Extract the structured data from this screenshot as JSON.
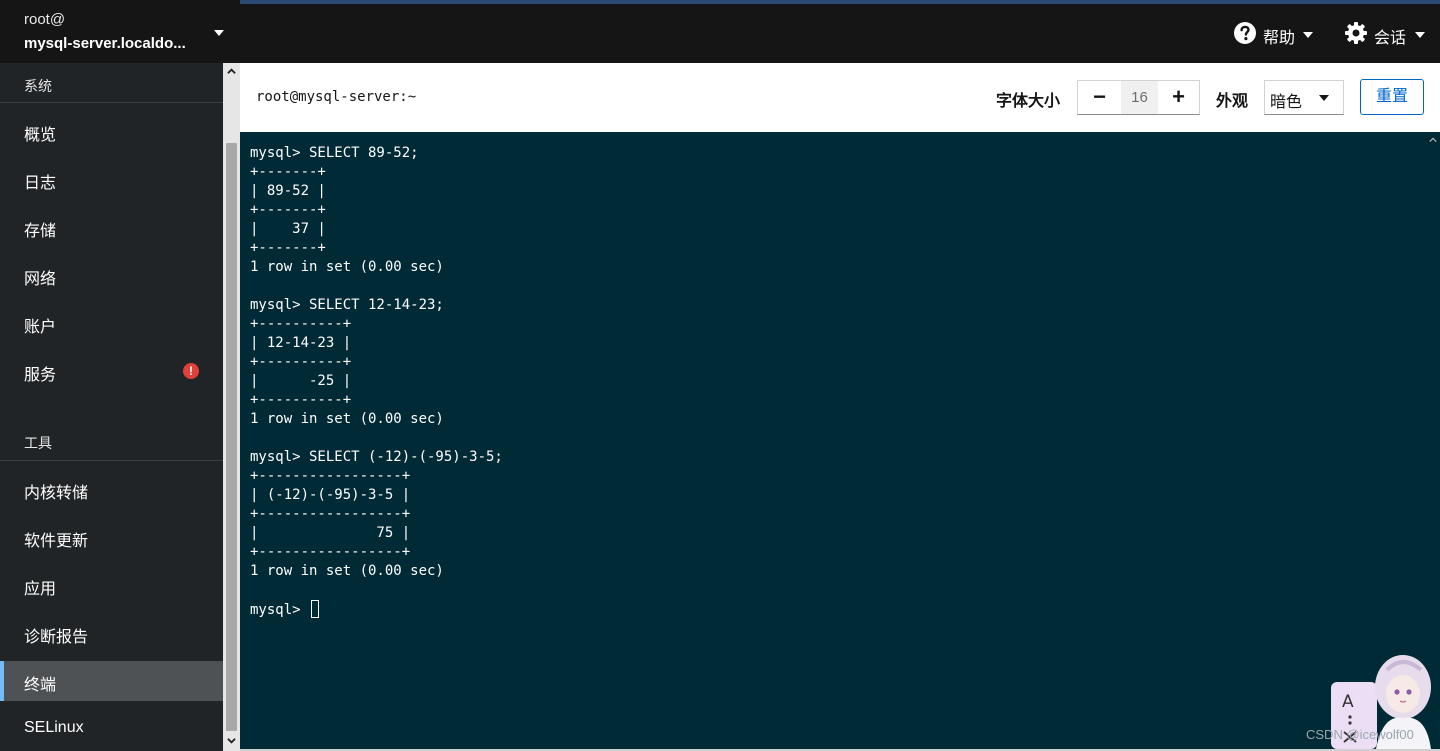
{
  "host": {
    "user": "root@",
    "name": "mysql-server.localdo..."
  },
  "sidebar": {
    "section_system": "系统",
    "system_items": [
      {
        "label": "概览"
      },
      {
        "label": "日志"
      },
      {
        "label": "存储"
      },
      {
        "label": "网络"
      },
      {
        "label": "账户"
      },
      {
        "label": "服务",
        "badge": "!"
      }
    ],
    "section_tools": "工具",
    "tools_items": [
      {
        "label": "内核转储"
      },
      {
        "label": "软件更新"
      },
      {
        "label": "应用"
      },
      {
        "label": "诊断报告"
      },
      {
        "label": "终端",
        "active": true
      },
      {
        "label": "SELinux"
      }
    ]
  },
  "topbar": {
    "help_label": "帮助",
    "session_label": "会话"
  },
  "toolbar": {
    "title": "root@mysql-server:~",
    "font_size_label": "字体大小",
    "font_size_value": "16",
    "decrement": "−",
    "increment": "+",
    "appearance_label": "外观",
    "appearance_value": "暗色",
    "reset_label": "重置"
  },
  "terminal": {
    "background": "#002b36",
    "lines": [
      "mysql> SELECT 89-52;",
      "+-------+",
      "| 89-52 |",
      "+-------+",
      "|    37 |",
      "+-------+",
      "1 row in set (0.00 sec)",
      "",
      "mysql> SELECT 12-14-23;",
      "+----------+",
      "| 12-14-23 |",
      "+----------+",
      "|      -25 |",
      "+----------+",
      "1 row in set (0.00 sec)",
      "",
      "mysql> SELECT (-12)-(-95)-3-5;",
      "+-----------------+",
      "| (-12)-(-95)-3-5 |",
      "+-----------------+",
      "|              75 |",
      "+-----------------+",
      "1 row in set (0.00 sec)",
      ""
    ],
    "prompt": "mysql> "
  },
  "icons": {
    "help": "question-circle-icon",
    "session": "gear-icon",
    "warning": "exclamation-circle-icon"
  },
  "colors": {
    "accent": "#0066cc",
    "active_nav_bar": "#73bcf7",
    "warning": "#e0403a"
  },
  "watermark": "CSDN @icewolf00"
}
